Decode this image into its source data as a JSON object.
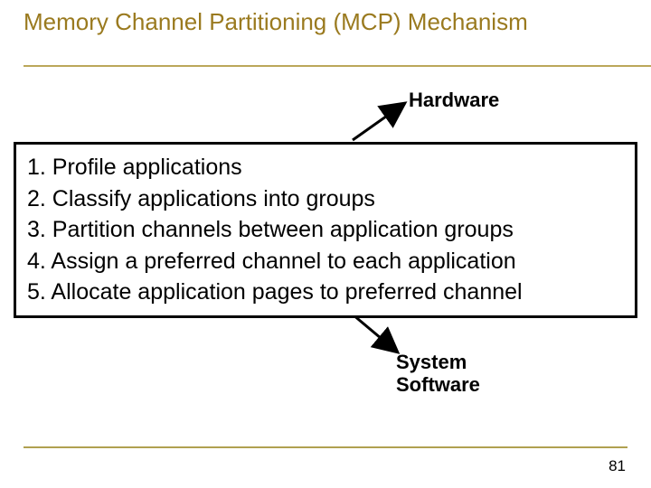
{
  "title": "Memory Channel Partitioning (MCP) Mechanism",
  "labels": {
    "hardware": "Hardware",
    "software": "System\nSoftware"
  },
  "steps": [
    "1. Profile applications",
    "2. Classify applications into groups",
    "3. Partition channels between application groups",
    "4. Assign a preferred channel to each application",
    "5. Allocate application pages to preferred channel"
  ],
  "page_number": "81"
}
